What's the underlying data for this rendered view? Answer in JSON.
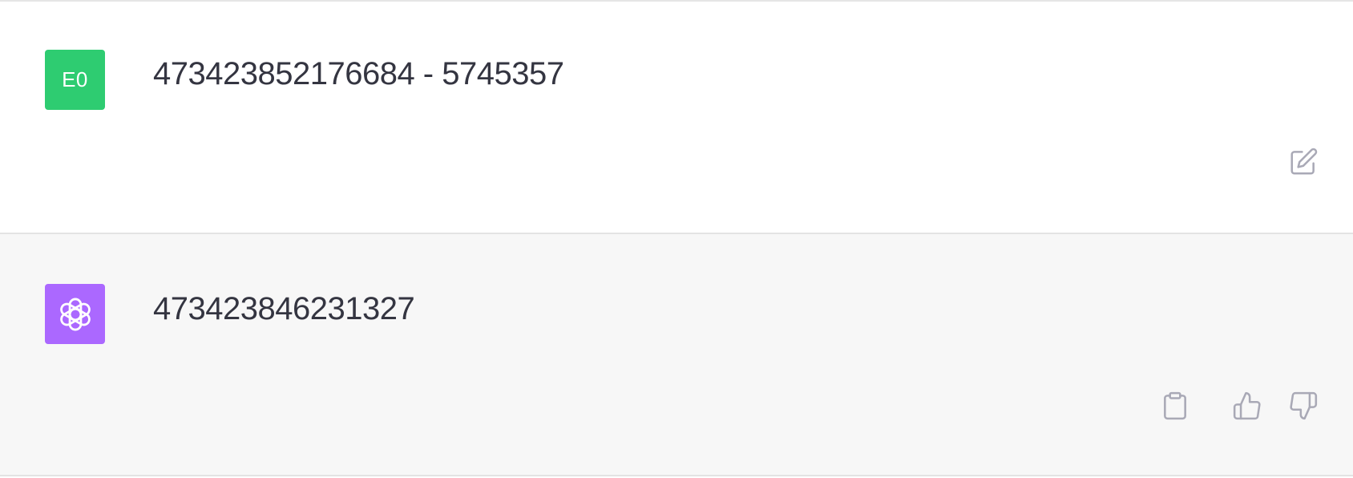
{
  "messages": {
    "user": {
      "avatar_initials": "E0",
      "avatar_color": "#2ecc71",
      "text": "473423852176684 - 5745357",
      "actions": {
        "edit_icon": "pencil-square-icon"
      }
    },
    "assistant": {
      "avatar_icon": "openai-logo-icon",
      "avatar_color": "#ab68ff",
      "text": "473423846231327",
      "actions": {
        "copy_icon": "clipboard-icon",
        "thumbs_up_icon": "thumbs-up-icon",
        "thumbs_down_icon": "thumbs-down-icon"
      }
    }
  },
  "colors": {
    "text": "#343541",
    "icon": "#a9a9b6",
    "assistant_background": "#f7f7f7",
    "divider": "#e3e3e3"
  }
}
